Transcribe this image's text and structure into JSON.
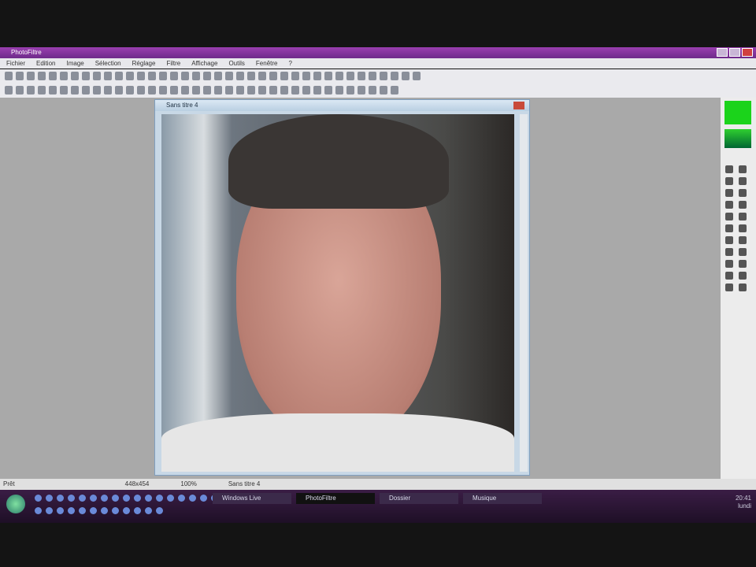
{
  "app": {
    "title": "PhotoFiltre"
  },
  "menu": [
    "Fichier",
    "Edition",
    "Image",
    "Sélection",
    "Réglage",
    "Filtre",
    "Affichage",
    "Outils",
    "Fenêtre",
    "?"
  ],
  "document": {
    "title": "Sans titre 4"
  },
  "statusbar": {
    "left": "Prêt",
    "size": "448x454",
    "zoom": "100%",
    "file": "Sans titre 4"
  },
  "taskbar": {
    "items": [
      "Windows Live",
      "PhotoFiltre",
      "Dossier",
      "Musique"
    ],
    "time": "20:41",
    "date": "lundi"
  },
  "colors": {
    "foreground": "#1bd31b",
    "titlebar": "#8a35a0"
  }
}
